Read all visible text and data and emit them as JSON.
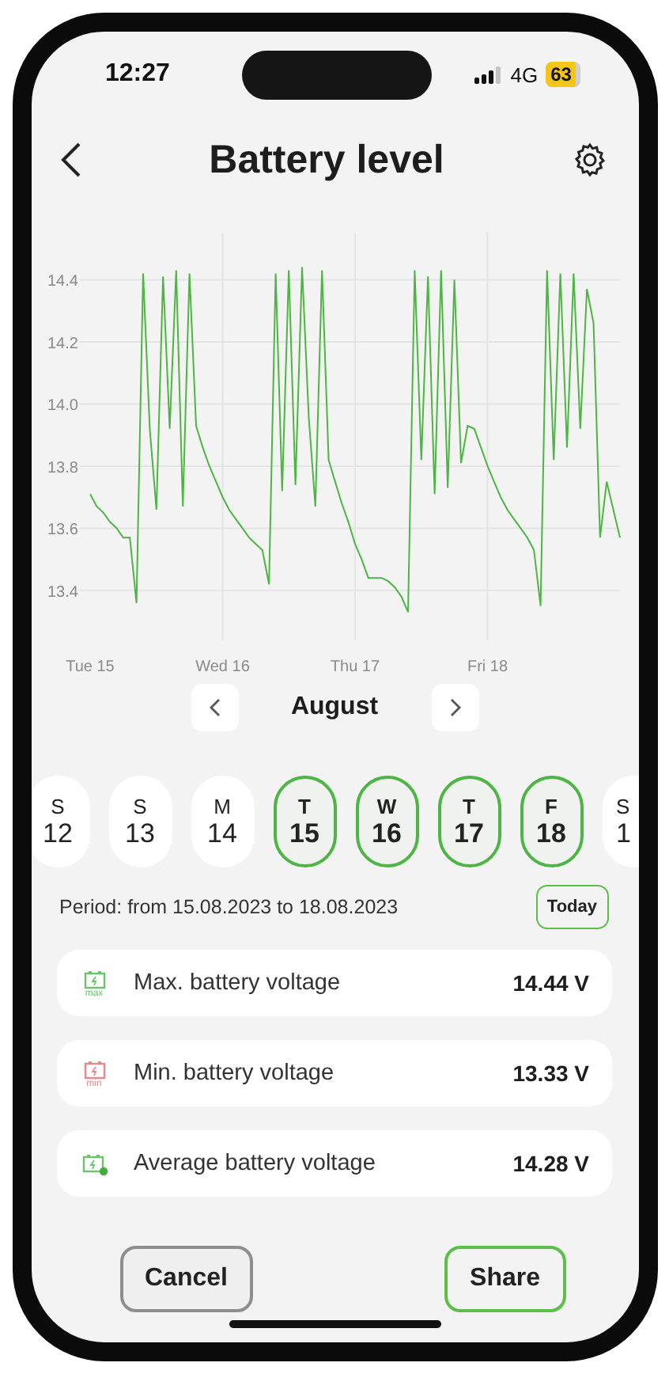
{
  "status_bar": {
    "time": "12:27",
    "network": "4G",
    "battery": "63"
  },
  "header": {
    "title": "Battery level"
  },
  "chart": {
    "chart_data": {
      "type": "line",
      "grid": true,
      "ylim": [
        13.24,
        14.55
      ],
      "yticks": [
        {
          "value": 14.4,
          "label": "14.4"
        },
        {
          "value": 14.2,
          "label": "14.2"
        },
        {
          "value": 14.0,
          "label": "14.0"
        },
        {
          "value": 13.8,
          "label": "13.8"
        },
        {
          "value": 13.6,
          "label": "13.6"
        },
        {
          "value": 13.4,
          "label": "13.4"
        }
      ],
      "categories": [
        "Tue 15",
        null,
        null,
        null,
        null,
        null,
        null,
        null,
        null,
        null,
        null,
        null,
        null,
        null,
        null,
        null,
        null,
        null,
        null,
        null,
        "Wed 16",
        null,
        null,
        null,
        null,
        null,
        null,
        null,
        null,
        null,
        null,
        null,
        null,
        null,
        null,
        null,
        null,
        null,
        null,
        null,
        "Thu 17",
        null,
        null,
        null,
        null,
        null,
        null,
        null,
        null,
        null,
        null,
        null,
        null,
        null,
        null,
        null,
        null,
        null,
        null,
        null,
        "Fri 18",
        null,
        null,
        null,
        null,
        null,
        null,
        null,
        null,
        null,
        null,
        null,
        null,
        null,
        null,
        null,
        null,
        null,
        null,
        null,
        null
      ],
      "series": [
        {
          "color": "#4cb543",
          "values": [
            13.71,
            13.67,
            13.65,
            13.62,
            13.6,
            13.57,
            13.57,
            13.36,
            14.42,
            13.92,
            13.66,
            14.41,
            13.92,
            14.43,
            13.67,
            14.42,
            13.93,
            13.86,
            13.8,
            13.75,
            13.7,
            13.66,
            13.63,
            13.6,
            13.57,
            13.55,
            13.53,
            13.42,
            14.42,
            13.72,
            14.43,
            13.74,
            14.44,
            13.96,
            13.67,
            14.43,
            13.82,
            13.75,
            13.68,
            13.62,
            13.55,
            13.5,
            13.44,
            13.44,
            13.44,
            13.43,
            13.41,
            13.38,
            13.33,
            14.43,
            13.82,
            14.41,
            13.71,
            14.43,
            13.73,
            14.4,
            13.81,
            13.93,
            13.92,
            13.86,
            13.8,
            13.75,
            13.7,
            13.66,
            13.63,
            13.6,
            13.57,
            13.53,
            13.35,
            14.43,
            13.82,
            14.42,
            13.86,
            14.42,
            13.92,
            14.37,
            14.26,
            13.57,
            13.75,
            13.66,
            13.57
          ]
        }
      ]
    }
  },
  "month": {
    "label": "August"
  },
  "days": [
    {
      "weekday": "S",
      "day": "12",
      "selected": false
    },
    {
      "weekday": "S",
      "day": "13",
      "selected": false
    },
    {
      "weekday": "M",
      "day": "14",
      "selected": false
    },
    {
      "weekday": "T",
      "day": "15",
      "selected": true
    },
    {
      "weekday": "W",
      "day": "16",
      "selected": true
    },
    {
      "weekday": "T",
      "day": "17",
      "selected": true
    },
    {
      "weekday": "F",
      "day": "18",
      "selected": true
    },
    {
      "weekday": "S",
      "day": "1",
      "selected": false
    }
  ],
  "period": {
    "text": "Period: from 15.08.2023 to 18.08.2023",
    "today_button": "Today"
  },
  "stats": [
    {
      "kind": "max",
      "badge": "max",
      "color": "#6cc46a",
      "label": "Max. battery voltage",
      "value": "14.44 V"
    },
    {
      "kind": "min",
      "badge": "min",
      "color": "#e58a8a",
      "label": "Min. battery voltage",
      "value": "13.33 V"
    },
    {
      "kind": "average",
      "color": "#6cc46a",
      "label": "Average battery voltage",
      "value": "14.28 V"
    }
  ],
  "buttons": [
    {
      "kind": "cancel",
      "label": "Cancel"
    },
    {
      "kind": "share",
      "label": "Share"
    }
  ]
}
